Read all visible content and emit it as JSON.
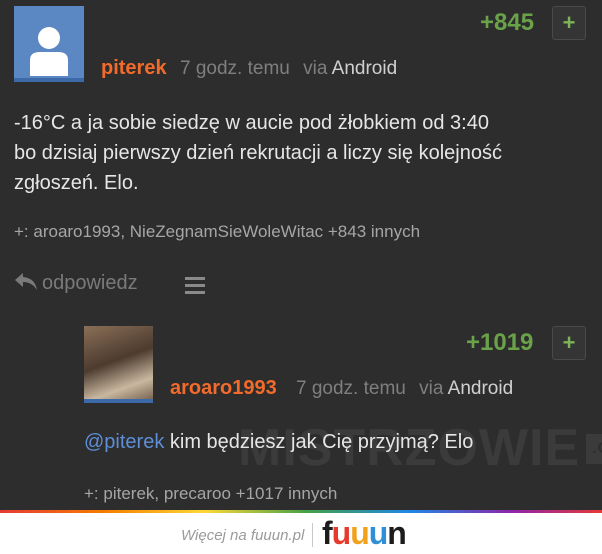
{
  "comment1": {
    "vote": "+845",
    "plus": "+",
    "author": "piterek",
    "time": "7 godz. temu",
    "via": "via",
    "source": "Android",
    "text_lines": [
      "-16°C a ja sobie siedzę w aucie pod żłobkiem od 3:40",
      "bo dzisiaj pierwszy dzień rekrutacji a liczy się kolejność",
      "zgłoszeń. Elo."
    ],
    "voters": "+: aroaro1993, NieZegnamSieWoleWitac +843 innych",
    "reply_label": "odpowiedz"
  },
  "comment2": {
    "vote": "+1019",
    "plus": "+",
    "author": "aroaro1993",
    "time": "7 godz. temu",
    "via": "via",
    "source": "Android",
    "mention": "@piterek",
    "text_rest": " kim będziesz jak Cię przyjmą? Elo",
    "voters": "+: piterek, precaroo +1017 innych"
  },
  "watermark": {
    "text": "MISTRZOWIE",
    "org": ".ORG"
  },
  "footer": {
    "more_text": "Więcej na fuuun.pl",
    "logo": [
      "f",
      "u",
      "u",
      "u",
      "n"
    ]
  },
  "colors": {
    "vote_green": "#6aa24a",
    "author_orange": "#f26b2b",
    "mention_blue": "#5d8ed6",
    "avatar_blue": "#5b87c3"
  }
}
